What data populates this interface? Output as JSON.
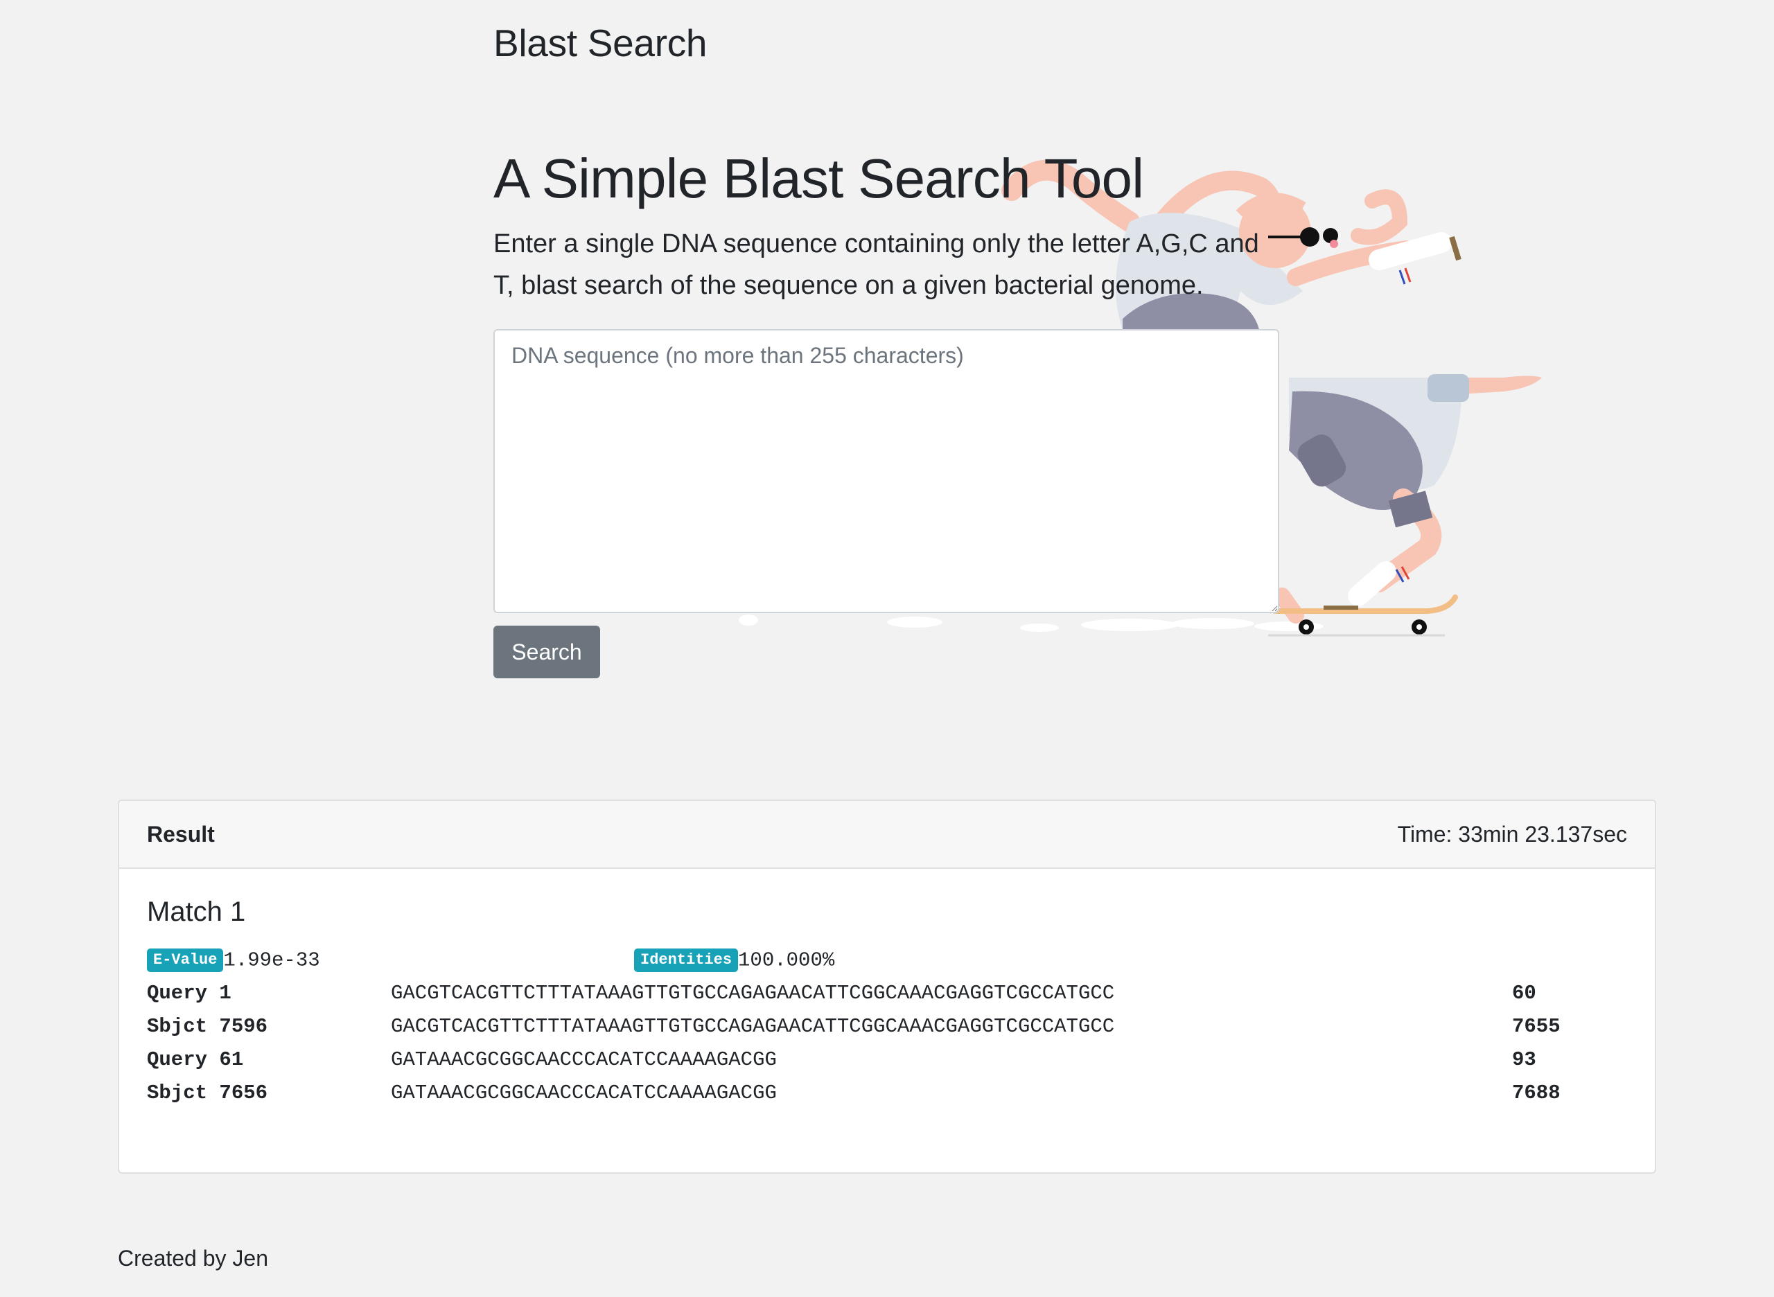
{
  "brand": "Blast Search",
  "hero": {
    "title": "A Simple Blast Search Tool",
    "description": "Enter a single DNA sequence containing only the letter A,G,C and T, blast search of the sequence on a given bacterial genome."
  },
  "search": {
    "placeholder": "DNA sequence (no more than 255 characters)",
    "button_label": "Search"
  },
  "result": {
    "title": "Result",
    "time": "Time: 33min 23.137sec",
    "matches": [
      {
        "title": "Match 1",
        "evalue_label": "E-Value",
        "evalue": "1.99e-33",
        "identities_label": "Identities",
        "identities": "100.000%",
        "rows": [
          {
            "label": "Query 1",
            "seq": "GACGTCACGTTCTTTATAAAGTTGTGCCAGAGAACATTCGGCAAACGAGGTCGCCATGCC",
            "end": "60"
          },
          {
            "label": "Sbjct 7596",
            "seq": "GACGTCACGTTCTTTATAAAGTTGTGCCAGAGAACATTCGGCAAACGAGGTCGCCATGCC",
            "end": "7655"
          },
          {
            "label": "Query 61",
            "seq": "GATAAACGCGGCAACCCACATCCAAAAGACGG",
            "end": "93"
          },
          {
            "label": "Sbjct 7656",
            "seq": "GATAAACGCGGCAACCCACATCCAAAAGACGG",
            "end": "7688"
          }
        ]
      }
    ]
  },
  "footer": "Created by Jen",
  "colors": {
    "background": "#f2f2f2",
    "badge": "#17a2b8",
    "button": "#6c757d"
  },
  "illustration": "skateboarder-illustration"
}
